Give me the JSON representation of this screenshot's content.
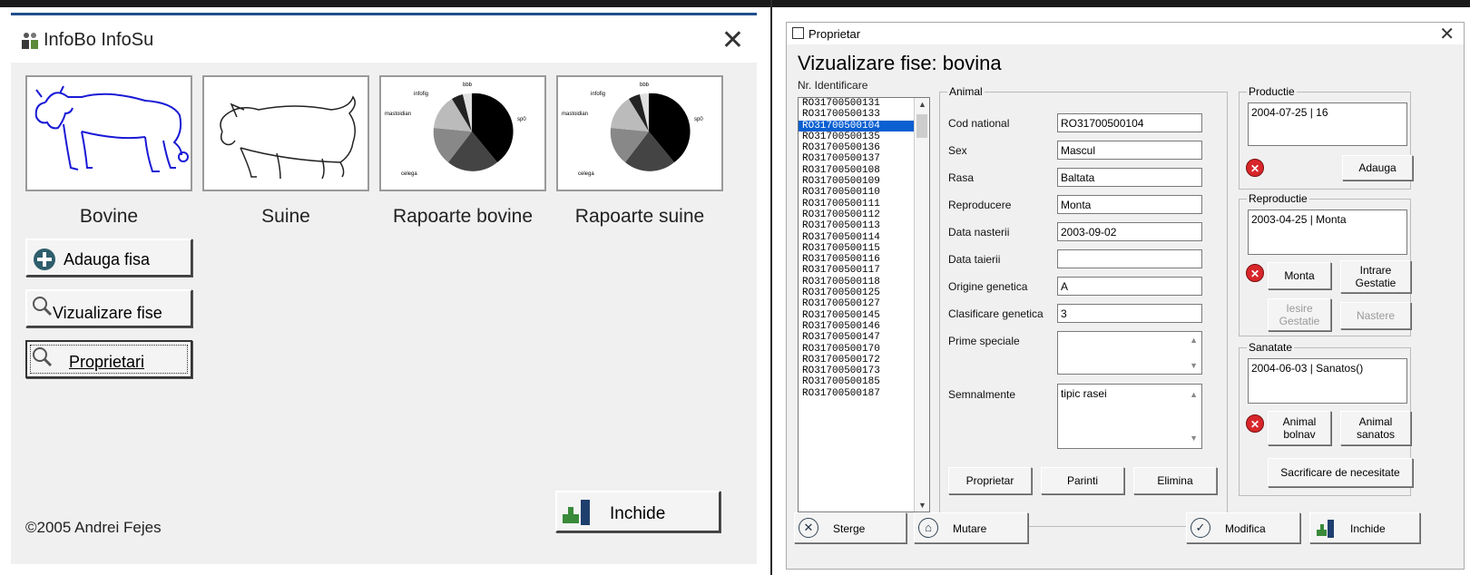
{
  "left_window": {
    "title": "InfoBo InfoSu",
    "close_icon": "close-icon",
    "tiles": [
      {
        "label": "Bovine",
        "icon": "cow-image"
      },
      {
        "label": "Suine",
        "icon": "pig-image"
      },
      {
        "label": "Rapoarte bovine",
        "icon": "pie-chart-image"
      },
      {
        "label": "Rapoarte suine",
        "icon": "pie-chart-image"
      }
    ],
    "pie_labels": {
      "a": "infofig",
      "b": "bbb",
      "c": "mastoidian",
      "d": "sp0",
      "e": "celega"
    },
    "buttons": {
      "add": "Adauga fisa",
      "view": "Vizualizare fise",
      "owners": "Proprietari",
      "close": "Inchide"
    },
    "copyright": "©2005 Andrei Fejes"
  },
  "right_window": {
    "title": "Proprietar",
    "heading": "Vizualizare fise: bovina",
    "list_label": "Nr. Identificare",
    "ids": [
      "RO31700500131",
      "RO31700500133",
      "RO31700500104",
      "RO31700500135",
      "RO31700500136",
      "RO31700500137",
      "RO31700500108",
      "RO31700500109",
      "RO31700500110",
      "RO31700500111",
      "RO31700500112",
      "RO31700500113",
      "RO31700500114",
      "RO31700500115",
      "RO31700500116",
      "RO31700500117",
      "RO31700500118",
      "RO31700500125",
      "RO31700500127",
      "RO31700500145",
      "RO31700500146",
      "RO31700500147",
      "RO31700500170",
      "RO31700500172",
      "RO31700500173",
      "RO31700500185",
      "RO31700500187"
    ],
    "selected_index": 2,
    "animal": {
      "group_title": "Animal",
      "fields": [
        {
          "label": "Cod national",
          "value": "RO31700500104"
        },
        {
          "label": "Sex",
          "value": "Mascul"
        },
        {
          "label": "Rasa",
          "value": "Baltata"
        },
        {
          "label": "Reproducere",
          "value": "Monta"
        },
        {
          "label": "Data nasterii",
          "value": "2003-09-02"
        },
        {
          "label": "Data taierii",
          "value": ""
        },
        {
          "label": "Origine genetica",
          "value": "A"
        },
        {
          "label": "Clasificare genetica",
          "value": "3"
        }
      ],
      "prime_label": "Prime speciale",
      "prime_value": "",
      "semnalmente_label": "Semnalmente",
      "semnalmente_value": "tipic rasei",
      "buttons": {
        "owner": "Proprietar",
        "parents": "Parinti",
        "remove": "Elimina"
      }
    },
    "productie": {
      "title": "Productie",
      "entry": "2004-07-25 | 16",
      "add": "Adauga"
    },
    "reproductie": {
      "title": "Reproductie",
      "entry": "2003-04-25 | Monta",
      "monta": "Monta",
      "intrare1": "Intrare",
      "intrare2": "Gestatie",
      "iesire1": "Iesire",
      "iesire2": "Gestatie",
      "nastere": "Nastere"
    },
    "sanatate": {
      "title": "Sanatate",
      "entry": "2004-06-03 | Sanatos()",
      "bolnav1": "Animal",
      "bolnav2": "bolnav",
      "sanatos1": "Animal",
      "sanatos2": "sanatos",
      "sacrificare": "Sacrificare de necesitate"
    },
    "bottom": {
      "delete": "Sterge",
      "move": "Mutare",
      "modify": "Modifica",
      "close": "Inchide"
    }
  }
}
